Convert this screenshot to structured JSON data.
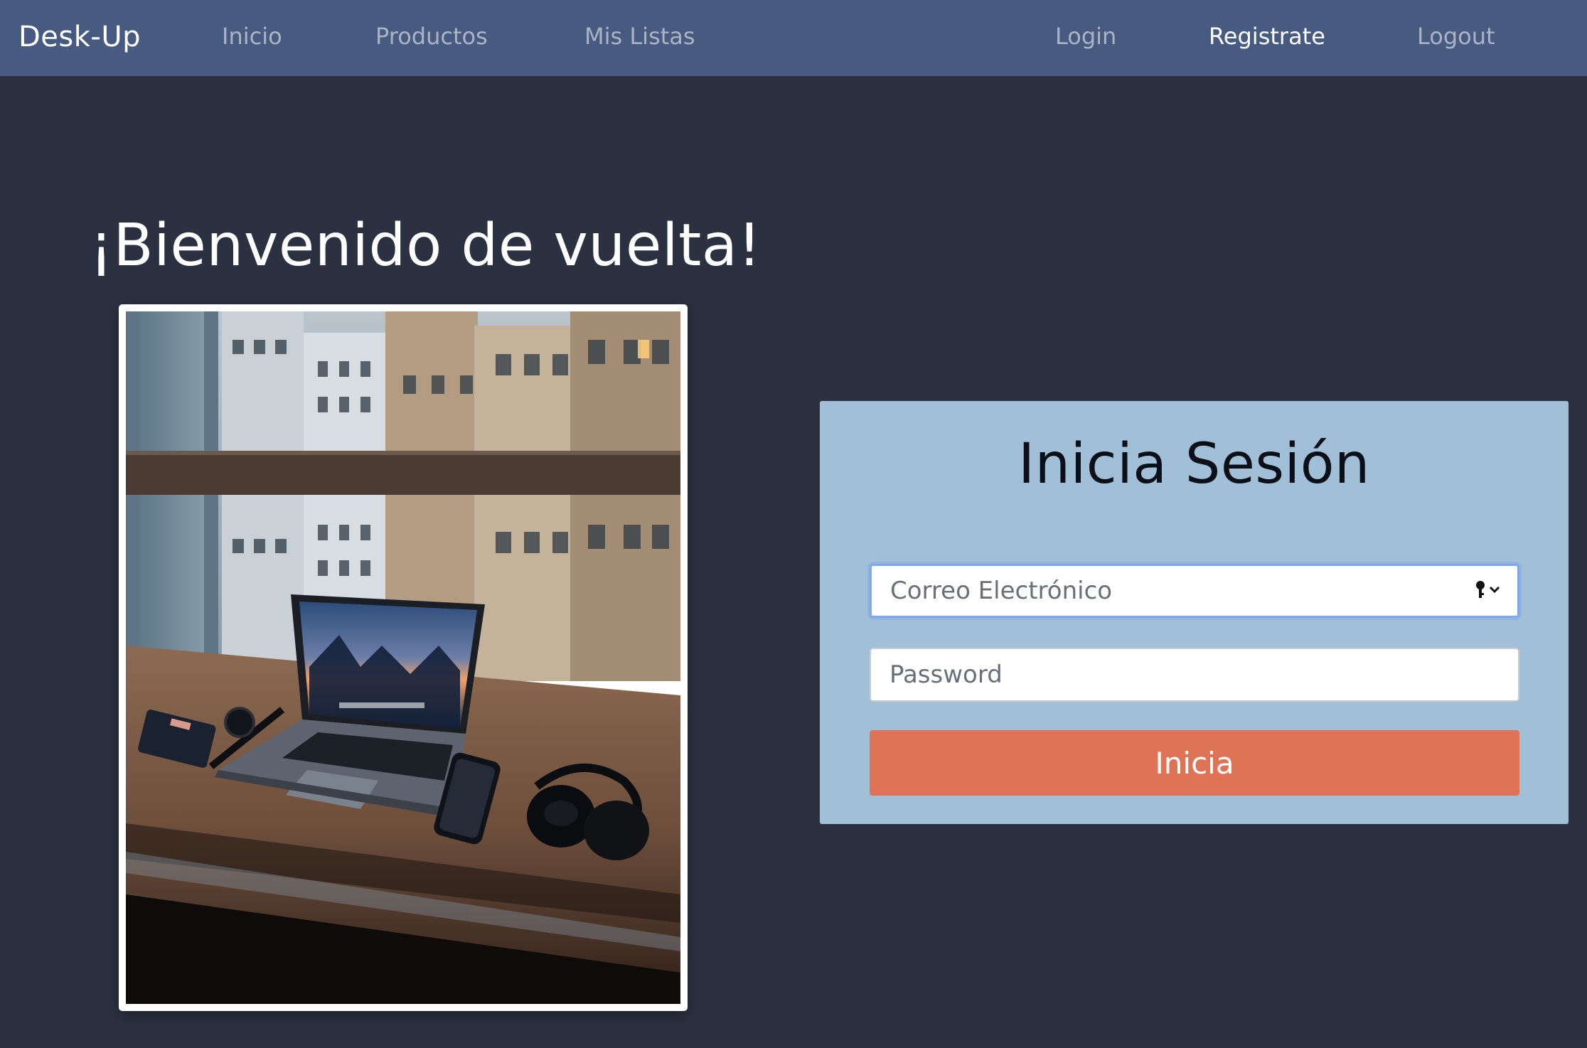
{
  "navbar": {
    "brand": "Desk-Up",
    "left_links": [
      "Inicio",
      "Productos",
      "Mis Listas"
    ],
    "right_links": [
      "Login",
      "Registrate",
      "Logout"
    ],
    "active": "Registrate"
  },
  "hero": {
    "welcome": "¡Bienvenido de vuelta!",
    "photo_description": "laptop-on-desk-by-window-photo"
  },
  "login": {
    "title": "Inicia Sesión",
    "email_placeholder": "Correo Electrónico",
    "password_placeholder": "Password",
    "submit_label": "Inicia"
  },
  "colors": {
    "page_bg": "#2b3140",
    "navbar_bg": "#475a80",
    "card_bg": "#a1bfd6",
    "button_bg": "#df7355",
    "focus_ring": "#7fa8e8"
  },
  "icons": {
    "autofill": "key-icon"
  }
}
